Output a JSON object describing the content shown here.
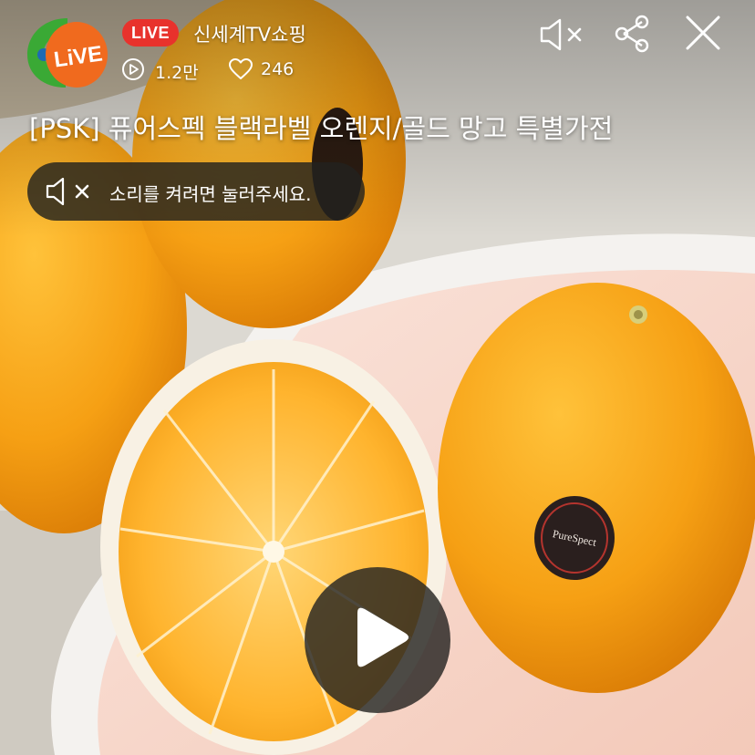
{
  "channel": {
    "logo_text": "LiVE",
    "live_badge": "LIVE",
    "name": "신세계TV쇼핑"
  },
  "stats": {
    "views": "1.2만",
    "likes": "246"
  },
  "product": {
    "title": "[PSK] 퓨어스펙 블랙라벨 오렌지/골드 망고 특별가전",
    "sticker_text": "PureSpect"
  },
  "sound_prompt": {
    "label": "소리를 켜려면 눌러주세요."
  },
  "icons": {
    "views": "play-circle-icon",
    "likes": "heart-outline-icon",
    "mute": "speaker-muted-icon",
    "share": "share-icon",
    "close": "close-icon",
    "play": "play-icon"
  },
  "colors": {
    "live_badge": "#e8322c",
    "logo_green": "#3aa935",
    "logo_orange": "#f06a1e",
    "orange_fruit": "#f7a114"
  }
}
